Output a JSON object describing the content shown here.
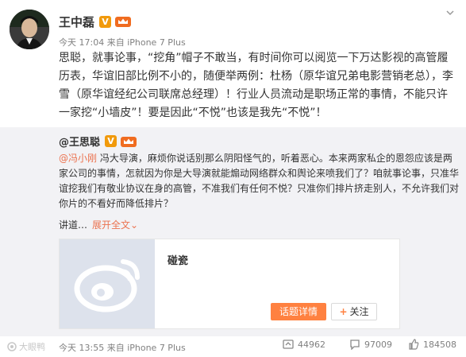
{
  "post": {
    "author": "王中磊",
    "meta": "今天 17:04 来自 iPhone 7 Plus",
    "text": "思聪，就事论事，“挖角”帽子不敢当，有时间你可以阅览一下万达影视的高管履历表，华谊旧部比例不小的，随便举两例：杜杨（原华谊兄弟电影营销老总），李雪（原华谊经纪公司联席总经理）！行业人员流动是职场正常的事情，不能只许一家挖“小墙皮”！要是因此“不悦”也该是我先“不悦”！"
  },
  "repost": {
    "author": "@王思聪",
    "mention": "@冯小刚",
    "text": " 冯大导演，麻烦你说话别那么阴阳怪气的，听着恶心。本来两家私企的恩怨应该是两家公司的事情，怎就因为你是大导演就能煽动网络群众和舆论来喷我们了？咱就事论事，只准华谊挖我们有敬业协议在身的高管，不准我们有任何不悦？只准你们排片挤走别人，不允许我们对你片的不看好而降低排片？",
    "more": "讲道…",
    "expand": "展开全文",
    "expand_arrow": "⌄",
    "card": {
      "title": "碰瓷",
      "topic_button": "话题详情",
      "follow_plus": "+",
      "follow_button": "关注"
    },
    "meta": "今天 13:55 来自 iPhone 7 Plus",
    "stats": {
      "reposts": "44962",
      "comments": "97009",
      "likes": "184508"
    }
  },
  "watermark": "大眼鸭",
  "colors": {
    "accent": "#eb7350",
    "badge": "#f19a0c",
    "button": "#ff8140"
  }
}
